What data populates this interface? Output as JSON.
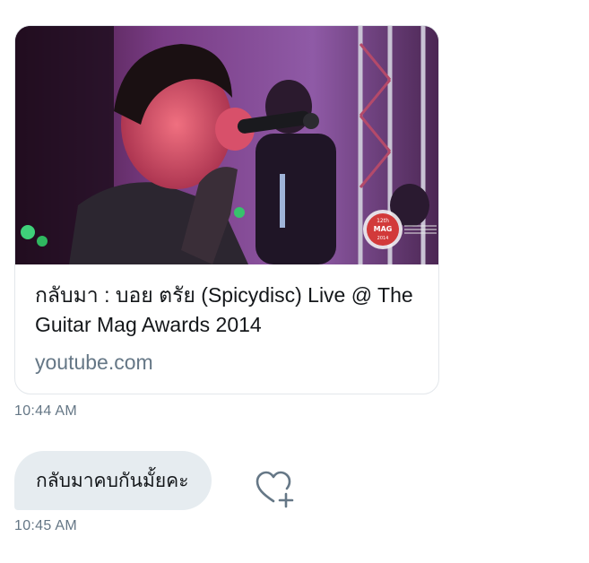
{
  "link_card": {
    "title": "กลับมา : บอย ตรัย (Spicydisc) Live @ The Guitar Mag Awards 2014",
    "domain": "youtube.com",
    "thumbnail_badge": "12th THE GUITAR MAG AWARDS 2014"
  },
  "messages": [
    {
      "timestamp": "10:44 AM"
    },
    {
      "text": "กลับมาคบกันมั้ยคะ",
      "timestamp": "10:45 AM"
    }
  ],
  "icons": {
    "like": "heart-plus-icon"
  },
  "colors": {
    "bubble_bg": "#e6ecf0",
    "secondary_text": "#657786",
    "primary_text": "#14171a",
    "card_border": "#e3e7eb"
  }
}
